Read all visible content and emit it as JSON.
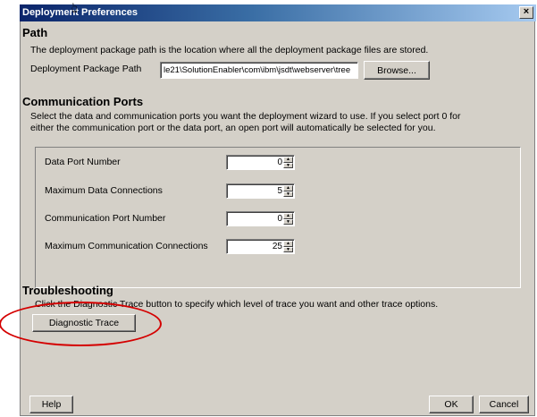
{
  "window": {
    "title": "Deployment Preferences",
    "close_glyph": "×"
  },
  "path_section": {
    "title": "Path",
    "description": "The deployment package path is the location where all the deployment package files are stored.",
    "package_path_label": "Deployment Package Path",
    "package_path_value": "le21\\SolutionEnabler\\com\\ibm\\jsdt\\webserver\\tree",
    "browse_label": "Browse..."
  },
  "ports_section": {
    "title": "Communication Ports",
    "description_line1": "Select the data and communication ports you want the deployment wizard to use. If you select port 0 for",
    "description_line2": "either the communication port or the data port, an open port will automatically be selected for you.",
    "fields": [
      {
        "label": "Data Port Number",
        "value": "0"
      },
      {
        "label": "Maximum Data Connections",
        "value": "5"
      },
      {
        "label": "Communication Port Number",
        "value": "0"
      },
      {
        "label": "Maximum Communication Connections",
        "value": "25"
      }
    ]
  },
  "troubleshooting_section": {
    "title": "Troubleshooting",
    "description": "Click the Diagnostic Trace button to specify which level of trace you want and other trace options.",
    "diagnostic_trace_label": "Diagnostic Trace"
  },
  "footer": {
    "help_label": "Help",
    "ok_label": "OK",
    "cancel_label": "Cancel"
  },
  "colors": {
    "dialog_bg": "#d4d0c8",
    "title_bar": "#0a246a",
    "annotation_red": "#d40000"
  }
}
